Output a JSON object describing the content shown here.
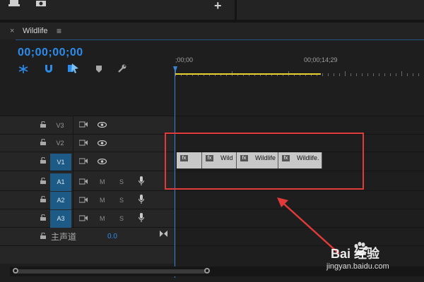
{
  "top_bar": {
    "plus_label": "+"
  },
  "panel": {
    "close_label": "×",
    "title": "Wildlife",
    "menu_label": "≡"
  },
  "timecode": "00;00;00;00",
  "ruler": {
    "start_label": ";00;00",
    "mark_label": "00;00;14;29"
  },
  "tracks": [
    {
      "label": "V3",
      "kind": "video",
      "active": false
    },
    {
      "label": "V2",
      "kind": "video",
      "active": false
    },
    {
      "label": "V1",
      "kind": "video",
      "active": true
    },
    {
      "label": "A1",
      "kind": "audio",
      "active": true,
      "m": "M",
      "s": "S"
    },
    {
      "label": "A2",
      "kind": "audio",
      "active": true,
      "m": "M",
      "s": "S"
    },
    {
      "label": "A3",
      "kind": "audio",
      "active": true,
      "m": "M",
      "s": "S"
    }
  ],
  "master": {
    "label": "主声道",
    "value": "0.0"
  },
  "clips": [
    {
      "name": ""
    },
    {
      "name": "Wild"
    },
    {
      "name": "Wildlife"
    },
    {
      "name": "Wildlife."
    }
  ],
  "watermark": {
    "brand": "Bai 经验",
    "url": "jingyan.baidu.com"
  },
  "colors": {
    "accent": "#2d8ceb",
    "highlight": "#e03a3a",
    "work_area": "#e5d22f",
    "track_active": "#1d5a85"
  }
}
